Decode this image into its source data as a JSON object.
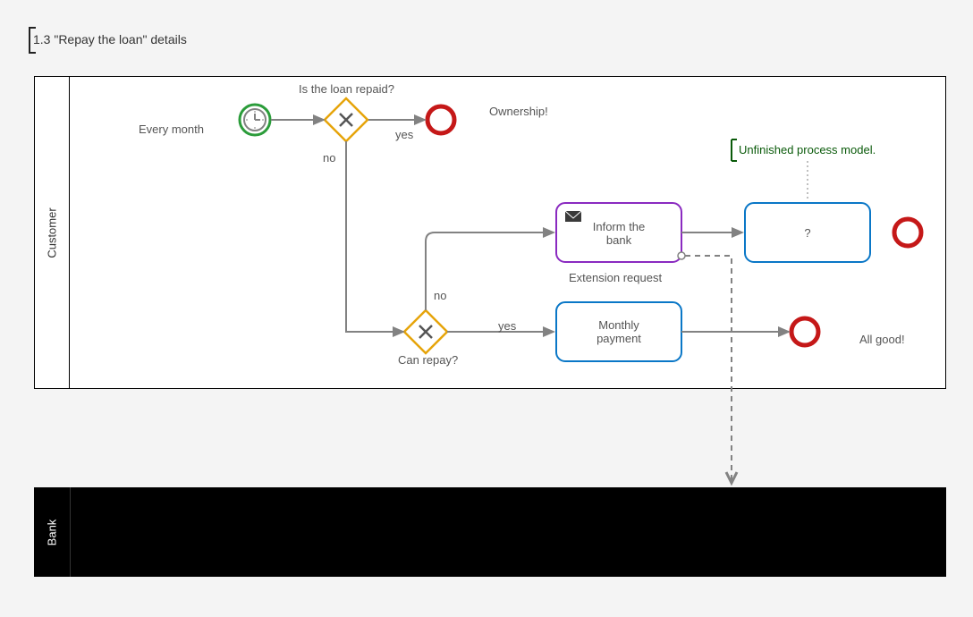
{
  "diagram_title": "1.3 \"Repay the loan\" details",
  "lanes": {
    "customer": "Customer",
    "bank": "Bank"
  },
  "events": {
    "start_label": "Every month",
    "end_top_label": "Ownership!",
    "end_bottom_label": "All good!"
  },
  "gateways": {
    "g1_label": "Is the loan repaid?",
    "g1_yes": "yes",
    "g1_no": "no",
    "g2_label": "Can repay?",
    "g2_yes": "yes",
    "g2_no": "no"
  },
  "tasks": {
    "inform_bank": "Inform the\nbank",
    "inform_bank_sub": "Extension request",
    "monthly_payment": "Monthly\npayment",
    "unknown": "?"
  },
  "annotation": "Unfinished process model.",
  "chart_data": {
    "type": "bpmn-diagram",
    "pools": [
      {
        "name": "Customer",
        "lanes": [
          "Customer"
        ]
      },
      {
        "name": "Bank",
        "lanes": [
          "Bank"
        ],
        "blackbox": true
      }
    ],
    "nodes": [
      {
        "id": "start",
        "type": "timer-start-event",
        "label": "Every month",
        "lane": "Customer"
      },
      {
        "id": "g1",
        "type": "exclusive-gateway",
        "label": "Is the loan repaid?",
        "lane": "Customer"
      },
      {
        "id": "end_top",
        "type": "end-event",
        "label": "Ownership!",
        "lane": "Customer"
      },
      {
        "id": "g2",
        "type": "exclusive-gateway",
        "label": "Can repay?",
        "lane": "Customer"
      },
      {
        "id": "inform",
        "type": "send-task",
        "label": "Inform the bank",
        "attached_label": "Extension request",
        "lane": "Customer"
      },
      {
        "id": "unknown",
        "type": "task",
        "label": "?",
        "lane": "Customer"
      },
      {
        "id": "end_right",
        "type": "end-event",
        "lane": "Customer"
      },
      {
        "id": "pay",
        "type": "task",
        "label": "Monthly payment",
        "lane": "Customer"
      },
      {
        "id": "end_bottom",
        "type": "end-event",
        "label": "All good!",
        "lane": "Customer"
      }
    ],
    "sequence_flows": [
      {
        "from": "start",
        "to": "g1"
      },
      {
        "from": "g1",
        "to": "end_top",
        "condition": "yes"
      },
      {
        "from": "g1",
        "to": "g2",
        "condition": "no"
      },
      {
        "from": "g2",
        "to": "pay",
        "condition": "yes"
      },
      {
        "from": "g2",
        "to": "inform",
        "condition": "no"
      },
      {
        "from": "inform",
        "to": "unknown"
      },
      {
        "from": "unknown",
        "to": "end_right"
      },
      {
        "from": "pay",
        "to": "end_bottom"
      }
    ],
    "message_flows": [
      {
        "from": "inform",
        "to_pool": "Bank"
      }
    ],
    "annotations": [
      {
        "text": "Unfinished process model.",
        "attached_to": "unknown"
      }
    ]
  }
}
